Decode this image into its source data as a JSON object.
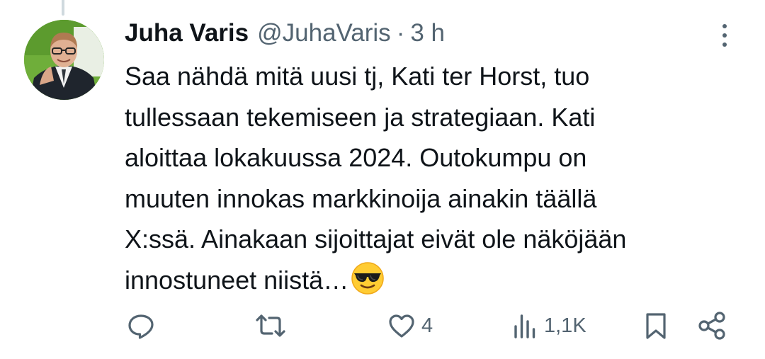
{
  "tweet": {
    "author": {
      "display_name": "Juha Varis",
      "handle": "@JuhaVaris"
    },
    "separator": "·",
    "time": "3 h",
    "text": "Saa nähdä mitä uusi tj, Kati ter Horst, tuo\ntullessaan tekemiseen ja strategiaan. Kati\naloittaa lokakuussa 2024. Outokumpu on\nmuuten innokas markkinoija ainakin täällä\nX:ssä. Ainakaan sijoittajat eivät ole näköjään\ninnostuneet niistä…",
    "emoji": "smiling-face-with-sunglasses",
    "more_icon": "more-vertical-icon"
  },
  "actions": {
    "reply": {
      "icon": "reply-icon",
      "count": ""
    },
    "retweet": {
      "icon": "retweet-icon",
      "count": ""
    },
    "like": {
      "icon": "heart-icon",
      "count": "4"
    },
    "views": {
      "icon": "views-icon",
      "count": "1,1K"
    },
    "bookmark": {
      "icon": "bookmark-icon"
    },
    "share": {
      "icon": "share-icon"
    }
  },
  "colors": {
    "text_primary": "#0f1419",
    "text_secondary": "#536471",
    "thread_line": "#cfd9de"
  }
}
